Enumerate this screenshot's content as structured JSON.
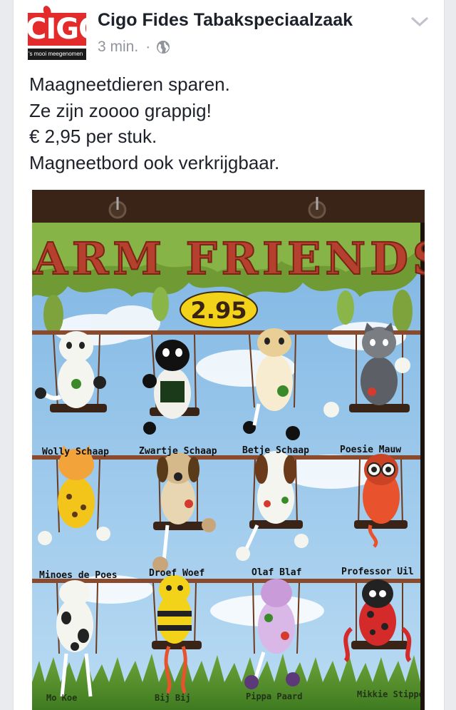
{
  "post": {
    "page_name": "Cigo Fides Tabakspeciaalzaak",
    "timestamp": "3 min.",
    "separator": "·",
    "audience_icon": "globe-icon",
    "menu_icon": "chevron-down-icon",
    "avatar": {
      "brand": "CIGO",
      "tagline": "'s mooi meegenomen",
      "colors": {
        "brand_red": "#e32b2b",
        "tagline_bg": "#1a1a1a"
      }
    },
    "text_lines": [
      "Maagneetdieren sparen.",
      "Ze zijn zoooo grappig!",
      "€ 2,95 per stuk.",
      "Magneetbord ook verkrijgbaar."
    ]
  },
  "photo": {
    "board_title": "FARM FRIENDS",
    "price": "2.95",
    "rows": [
      {
        "labels": [
          "Wolly Schaap",
          "Zwartje Schaap",
          "Betje Schaap",
          "Poesie Mauw"
        ]
      },
      {
        "labels": [
          "Minoes de Poes",
          "Droef Woef",
          "Olaf Blaf",
          "Professor Uil"
        ]
      },
      {
        "labels": [
          "Mo Koe",
          "Bij Bij",
          "Pippa Paard",
          "Mikkie Stippel"
        ]
      }
    ],
    "colors": {
      "sky": "#9cc8ea",
      "title_red": "#b5402e",
      "price_yellow": "#f3d21a",
      "shelf_brown": "#8b4a2b"
    }
  }
}
